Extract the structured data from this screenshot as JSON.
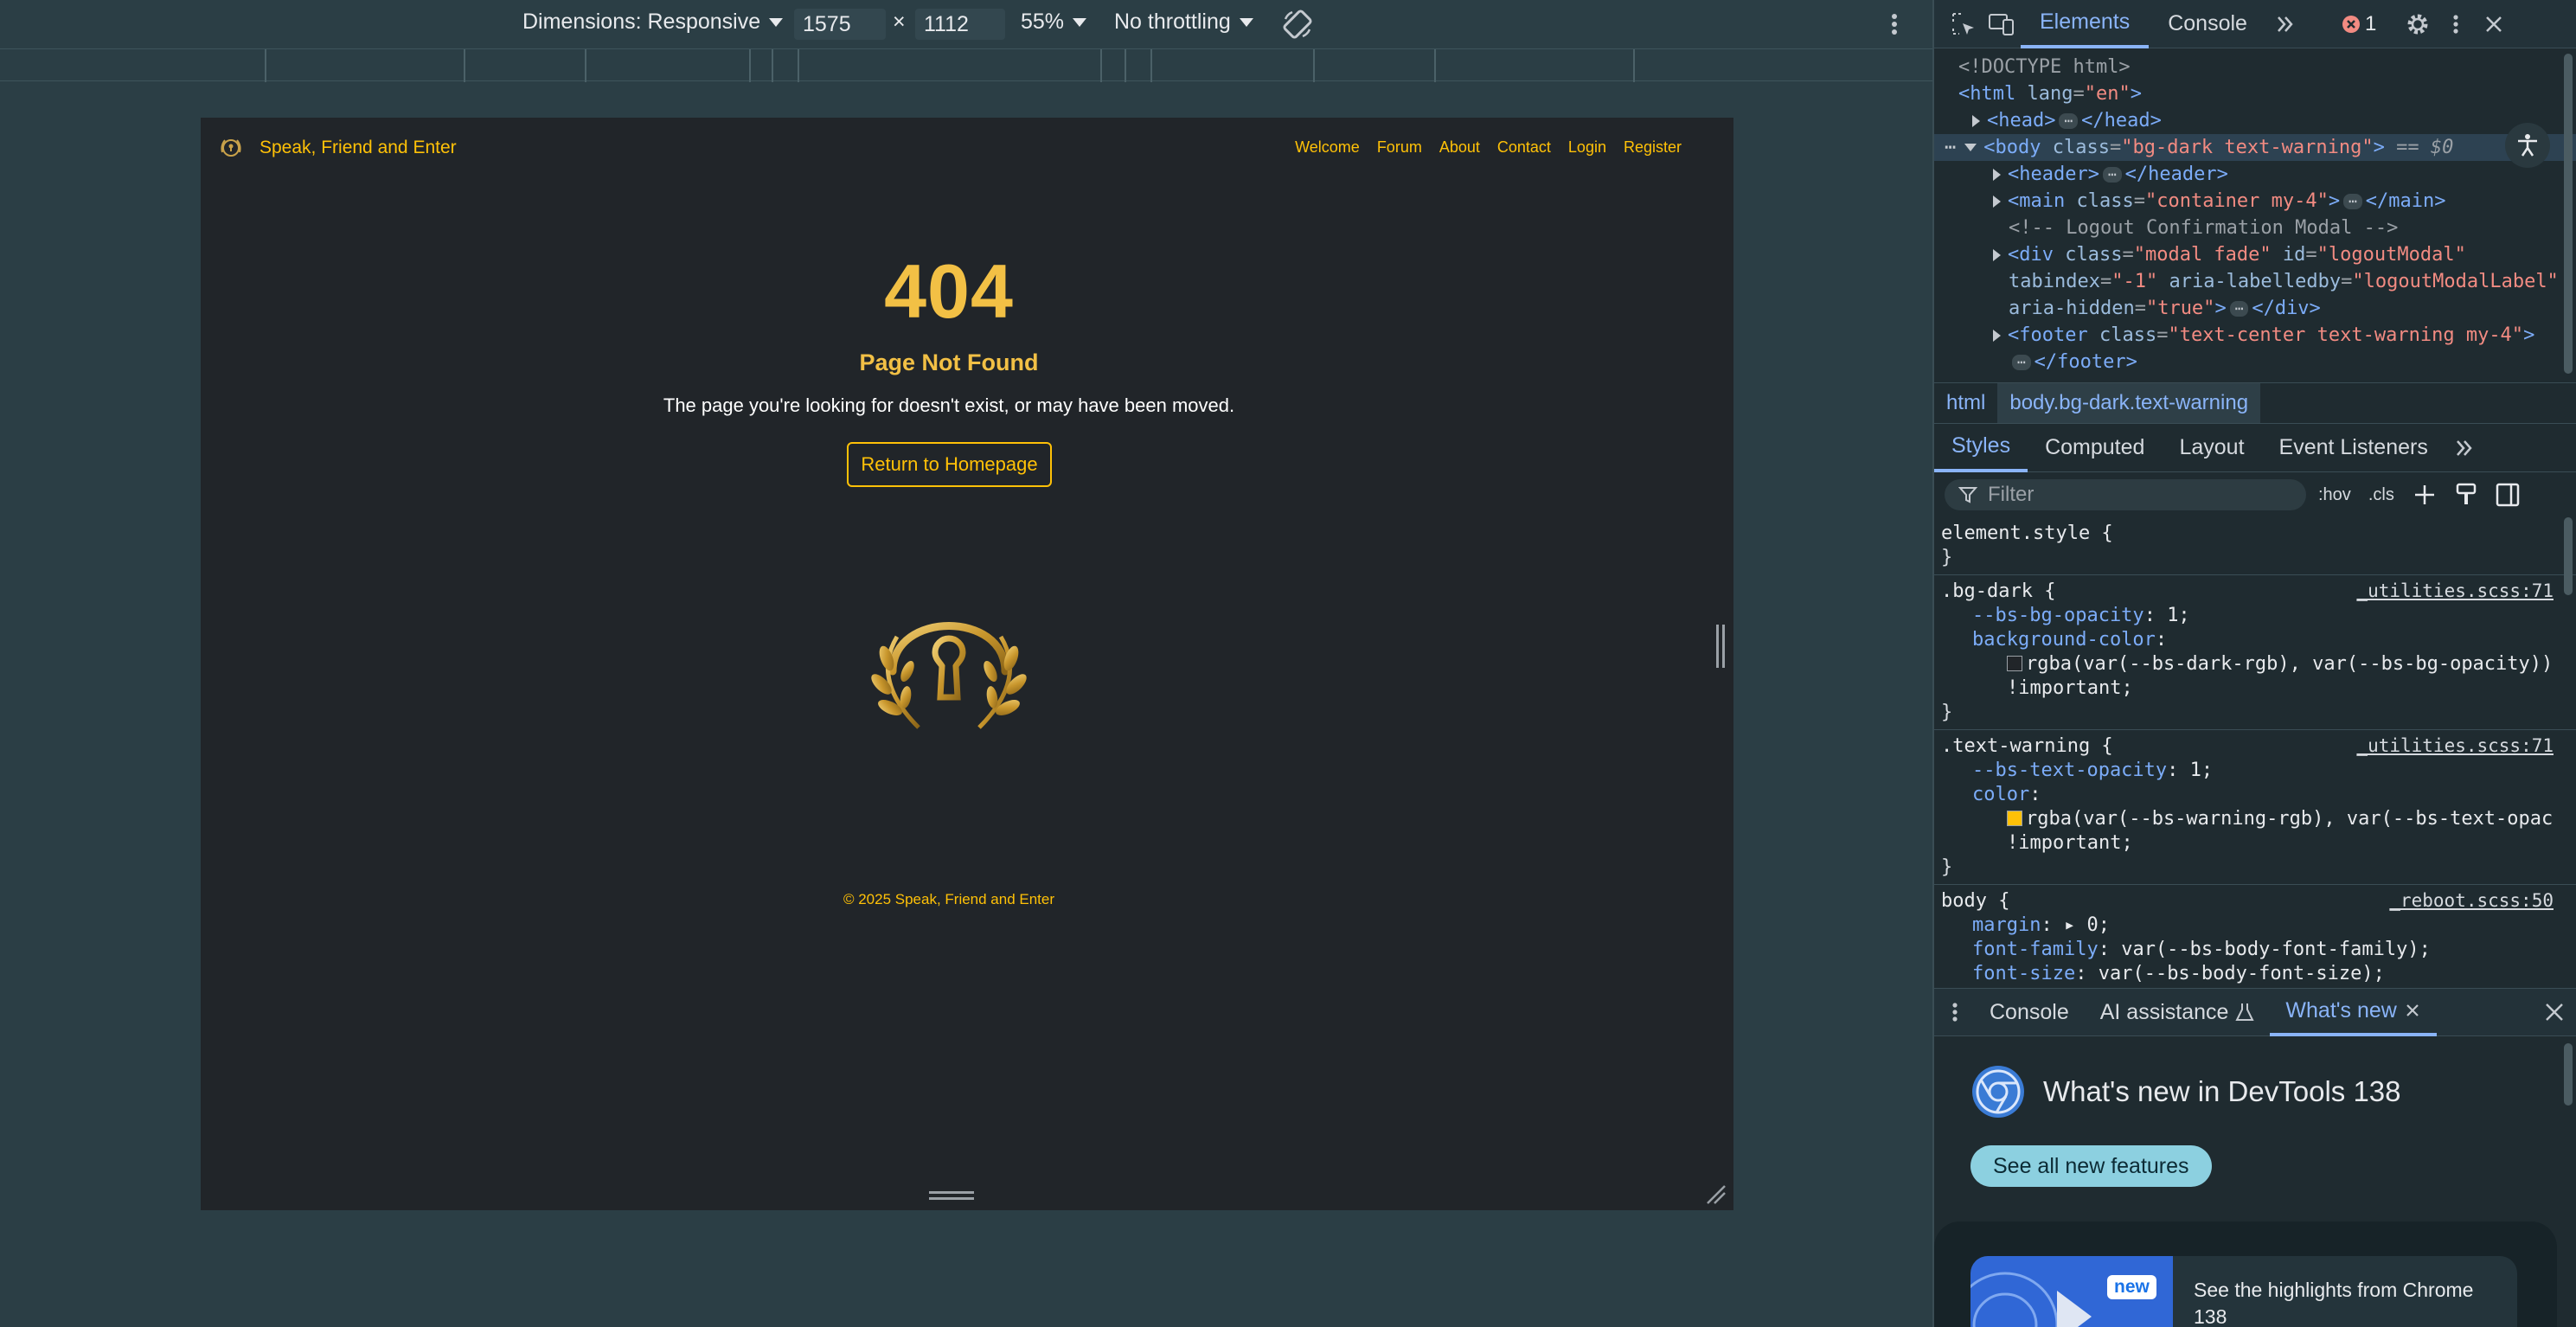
{
  "device_toolbar": {
    "dimensions_label": "Dimensions: Responsive",
    "width": "1575",
    "times": "×",
    "height": "1112",
    "zoom": "55%",
    "throttling": "No throttling"
  },
  "site": {
    "brand": "Speak, Friend and Enter",
    "nav": [
      "Welcome",
      "Forum",
      "About",
      "Contact",
      "Login",
      "Register"
    ],
    "error_code": "404",
    "error_title": "Page Not Found",
    "error_message": "The page you're looking for doesn't exist, or may have been moved.",
    "home_button": "Return to Homepage",
    "footer": "© 2025 Speak, Friend and Enter",
    "colors": {
      "background": "#212529",
      "accent": "#ffc107"
    }
  },
  "devtools": {
    "tabs": [
      "Elements",
      "Console"
    ],
    "error_count": "1",
    "tree": {
      "doctype": "<!DOCTYPE html>",
      "html_open": "<html",
      "html_attr": "lang",
      "html_val": "\"en\"",
      "head": "head",
      "body_class": "\"bg-dark text-warning\"",
      "eq": "== $0",
      "header": "header",
      "main_class": "\"container my-4\"",
      "main": "main",
      "comment": "<!-- Logout Confirmation Modal -->",
      "div_class": "\"modal fade\"",
      "div_id": "\"logoutModal\"",
      "tabindex": "\"-1\"",
      "labelledby": "\"logoutModalLabel\"",
      "hidden": "\"true\"",
      "footer_class": "\"text-center text-warning my-4\""
    },
    "breadcrumbs": [
      "html",
      "body.bg-dark.text-warning"
    ],
    "sub_tabs": [
      "Styles",
      "Computed",
      "Layout",
      "Event Listeners"
    ],
    "filter_placeholder": "Filter",
    "hov": ":hov",
    "cls": ".cls",
    "styles": {
      "element_style": "element.style {",
      "close": "}",
      "bg_dark_selector": ".bg-dark {",
      "bg_dark_source": "_utilities.scss:71",
      "bs_bg_opacity": "--bs-bg-opacity",
      "one": "1;",
      "background_color": "background-color",
      "bg_value": "rgba(var(--bs-dark-rgb), var(--bs-bg-opacity))",
      "important": "!important;",
      "text_warning_selector": ".text-warning {",
      "text_warning_source": "_utilities.scss:71",
      "bs_text_opacity": "--bs-text-opacity",
      "color_prop": "color",
      "color_value": "rgba(var(--bs-warning-rgb), var(--bs-text-opac",
      "body_selector": "body {",
      "body_source": "_reboot.scss:50",
      "margin": "margin",
      "margin_val": "0;",
      "font_family": "font-family",
      "font_family_val": "var(--bs-body-font-family);",
      "font_size": "font-size",
      "font_size_val": "var(--bs-body-font-size);"
    },
    "drawer_tabs": [
      "Console",
      "AI assistance",
      "What's new"
    ],
    "whats_new_title": "What's new in DevTools 138",
    "see_all": "See all new features",
    "new_badge": "new",
    "highlights": "See the highlights from Chrome 138"
  }
}
